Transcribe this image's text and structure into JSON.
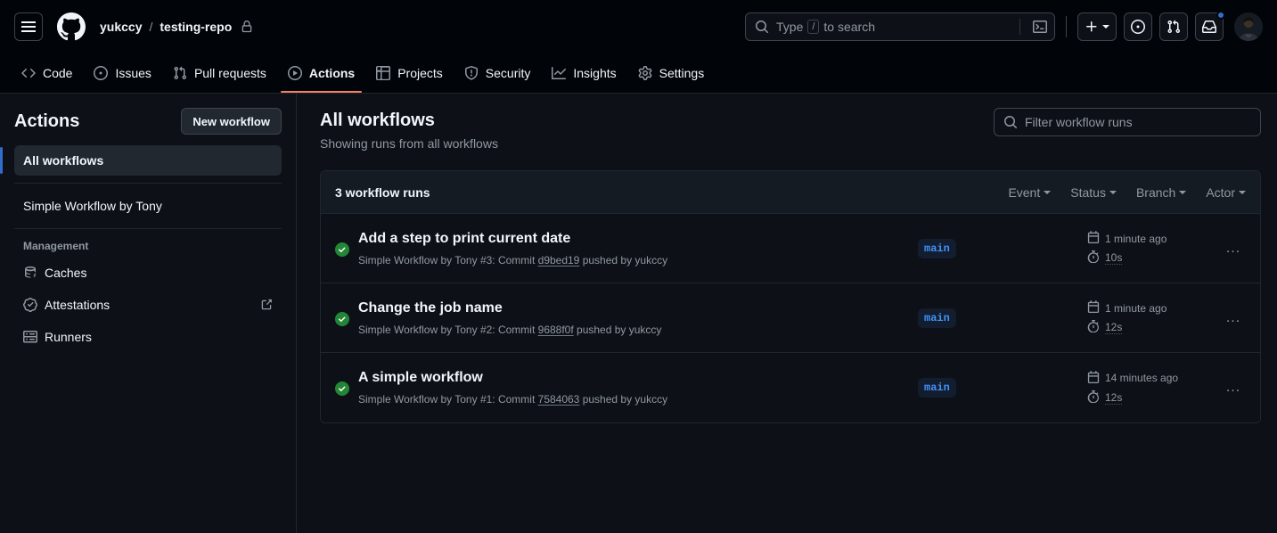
{
  "header": {
    "menu_icon": "hamburger-icon",
    "logo_icon": "github-logo-icon",
    "owner": "yukccy",
    "separator": "/",
    "repo": "testing-repo",
    "repo_visibility_icon": "lock-icon",
    "search": {
      "icon": "search-icon",
      "placeholder_pre": "Type",
      "placeholder_key": "/",
      "placeholder_post": "to search",
      "command_icon": "terminal-icon"
    },
    "create_new_icon": "plus-icon",
    "create_new_caret_icon": "chevron-down-icon",
    "issues_icon": "issue-opened-icon",
    "pull_requests_icon": "git-pull-request-icon",
    "inbox_icon": "inbox-icon",
    "has_notifications": true,
    "avatar_icon": "user-avatar"
  },
  "repo_nav": {
    "active": "Actions",
    "accent_color": "#f78166",
    "tabs": [
      {
        "label": "Code",
        "icon": "code-icon"
      },
      {
        "label": "Issues",
        "icon": "issue-opened-icon"
      },
      {
        "label": "Pull requests",
        "icon": "git-pull-request-icon"
      },
      {
        "label": "Actions",
        "icon": "play-icon"
      },
      {
        "label": "Projects",
        "icon": "table-icon"
      },
      {
        "label": "Security",
        "icon": "shield-icon"
      },
      {
        "label": "Insights",
        "icon": "graph-icon"
      },
      {
        "label": "Settings",
        "icon": "gear-icon"
      }
    ]
  },
  "sidebar": {
    "title": "Actions",
    "new_workflow_label": "New workflow",
    "workflows": [
      {
        "label": "All workflows",
        "active": true
      },
      {
        "label": "Simple Workflow by Tony",
        "active": false
      }
    ],
    "management_label": "Management",
    "management": [
      {
        "label": "Caches",
        "icon": "cache-icon",
        "external": false
      },
      {
        "label": "Attestations",
        "icon": "verified-icon",
        "external": true
      },
      {
        "label": "Runners",
        "icon": "server-icon",
        "external": false
      }
    ]
  },
  "main": {
    "title": "All workflows",
    "subtitle": "Showing runs from all workflows",
    "filter": {
      "icon": "search-icon",
      "placeholder": "Filter workflow runs"
    },
    "runs_count_label": "3 workflow runs",
    "filters": [
      {
        "label": "Event"
      },
      {
        "label": "Status"
      },
      {
        "label": "Branch"
      },
      {
        "label": "Actor"
      }
    ],
    "runs": [
      {
        "status": "success",
        "status_color": "#238636",
        "title": "Add a step to print current date",
        "meta_prefix": "Simple Workflow by Tony #3: Commit",
        "commit": "d9bed19",
        "meta_suffix": "pushed by yukccy",
        "branch": "main",
        "time_icon": "calendar-icon",
        "time": "1 minute ago",
        "duration_icon": "stopwatch-icon",
        "duration": "10s",
        "menu_icon": "kebab-horizontal-icon",
        "menu_label": "..."
      },
      {
        "status": "success",
        "status_color": "#238636",
        "title": "Change the job name",
        "meta_prefix": "Simple Workflow by Tony #2: Commit",
        "commit": "9688f0f",
        "meta_suffix": "pushed by yukccy",
        "branch": "main",
        "time_icon": "calendar-icon",
        "time": "1 minute ago",
        "duration_icon": "stopwatch-icon",
        "duration": "12s",
        "menu_icon": "kebab-horizontal-icon",
        "menu_label": "..."
      },
      {
        "status": "success",
        "status_color": "#238636",
        "title": "A simple workflow",
        "meta_prefix": "Simple Workflow by Tony #1: Commit",
        "commit": "7584063",
        "meta_suffix": "pushed by yukccy",
        "branch": "main",
        "time_icon": "calendar-icon",
        "time": "14 minutes ago",
        "duration_icon": "stopwatch-icon",
        "duration": "12s",
        "menu_icon": "kebab-horizontal-icon",
        "menu_label": "..."
      }
    ]
  },
  "colors": {
    "background": "#0d1117",
    "header_background": "#010409",
    "border": "#21262d",
    "accent_blue": "#316dca",
    "success_green": "#238636",
    "branch_badge_text": "#4493f8",
    "branch_badge_bg": "#121d2f"
  }
}
